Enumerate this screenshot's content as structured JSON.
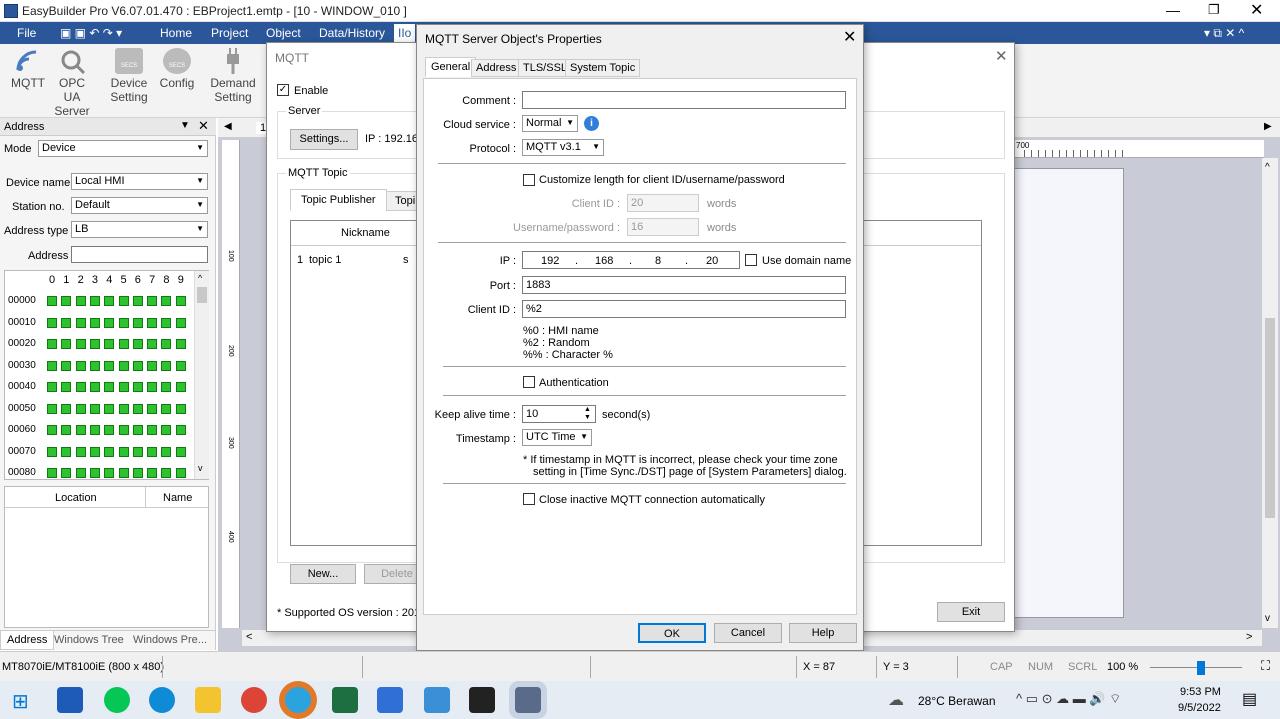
{
  "app": {
    "title": "EasyBuilder Pro V6.07.01.470 : EBProject1.emtp - [10 - WINDOW_010 ]"
  },
  "menu": {
    "file": "File",
    "home": "Home",
    "project": "Project",
    "object": "Object",
    "data_history": "Data/History",
    "iiot": "IIo"
  },
  "ribbon": {
    "mqtt": "MQTT",
    "opcua_1": "OPC UA",
    "opcua_2": "Server",
    "device_1": "Device",
    "device_2": "Setting",
    "config": "Config",
    "demand_1": "Demand",
    "demand_2": "Setting",
    "secs": "SECS"
  },
  "address_panel": {
    "title": "Address",
    "mode_label": "Mode",
    "mode_value": "Device",
    "device_name_label": "Device name",
    "device_name_value": "Local HMI",
    "station_label": "Station no.",
    "station_value": "Default",
    "addr_type_label": "Address type",
    "addr_type_value": "LB",
    "address_label": "Address",
    "cols": [
      "0",
      "1",
      "2",
      "3",
      "4",
      "5",
      "6",
      "7",
      "8",
      "9"
    ],
    "rows": [
      "00000",
      "00010",
      "00020",
      "00030",
      "00040",
      "00050",
      "00060",
      "00070",
      "00080"
    ],
    "location_header": "Location",
    "name_header": "Name",
    "tabs": [
      "Address",
      "Windows Tree",
      "Windows Pre..."
    ]
  },
  "canvas": {
    "tab": "10",
    "ruler": "700",
    "ruler_100": "100",
    "ruler_200": "200",
    "ruler_300": "300",
    "ruler_400": "400"
  },
  "mqtt_window": {
    "title": "MQTT",
    "enable": "Enable",
    "server": "Server",
    "settings_btn": "Settings...",
    "ip_text": "IP : 192.168",
    "topic_group": "MQTT Topic",
    "tab_publisher": "Topic Publisher",
    "tab_sub": "Topi",
    "col_nickname": "Nickname",
    "row_num": "1",
    "row_name": "topic 1",
    "row_extra": "s",
    "new_btn": "New...",
    "delete_btn": "Delete",
    "supported": "* Supported OS version : 201",
    "exit_btn": "Exit"
  },
  "dialog": {
    "title": "MQTT Server Object's Properties",
    "tabs": [
      "General",
      "Address",
      "TLS/SSL",
      "System Topic"
    ],
    "comment_label": "Comment :",
    "cloud_label": "Cloud service :",
    "cloud_value": "Normal",
    "protocol_label": "Protocol :",
    "protocol_value": "MQTT v3.1",
    "customize_label": "Customize length for client ID/username/password",
    "clientid_len_label": "Client ID :",
    "clientid_len_value": "20",
    "words": "words",
    "userpass_label": "Username/password :",
    "userpass_value": "16",
    "ip_label": "IP :",
    "ip": [
      "192",
      "168",
      "8",
      "20"
    ],
    "ip_dot": ".",
    "use_domain": "Use domain name",
    "port_label": "Port :",
    "port_value": "1883",
    "clientid_label": "Client ID :",
    "clientid_value": "%2",
    "hint1": "%0 : HMI name",
    "hint2": "%2 : Random",
    "hint3": "%% : Character %",
    "auth_label": "Authentication",
    "keepalive_label": "Keep alive time :",
    "keepalive_value": "10",
    "seconds": "second(s)",
    "timestamp_label": "Timestamp :",
    "timestamp_value": "UTC Time",
    "note1": "*  If timestamp in MQTT is incorrect, please check your time zone",
    "note2": "setting in [Time Sync./DST] page of [System Parameters] dialog.",
    "close_inactive": "Close inactive MQTT connection automatically",
    "ok": "OK",
    "cancel": "Cancel",
    "help": "Help"
  },
  "status": {
    "model": "MT8070iE/MT8100iE (800 x 480)",
    "x": "X = 87",
    "y": "Y = 3",
    "cap": "CAP",
    "num": "NUM",
    "scrl": "SCRL",
    "zoom": "100 %"
  },
  "taskbar": {
    "weather": "28°C  Berawan",
    "time": "9:53 PM",
    "date": "9/5/2022"
  }
}
